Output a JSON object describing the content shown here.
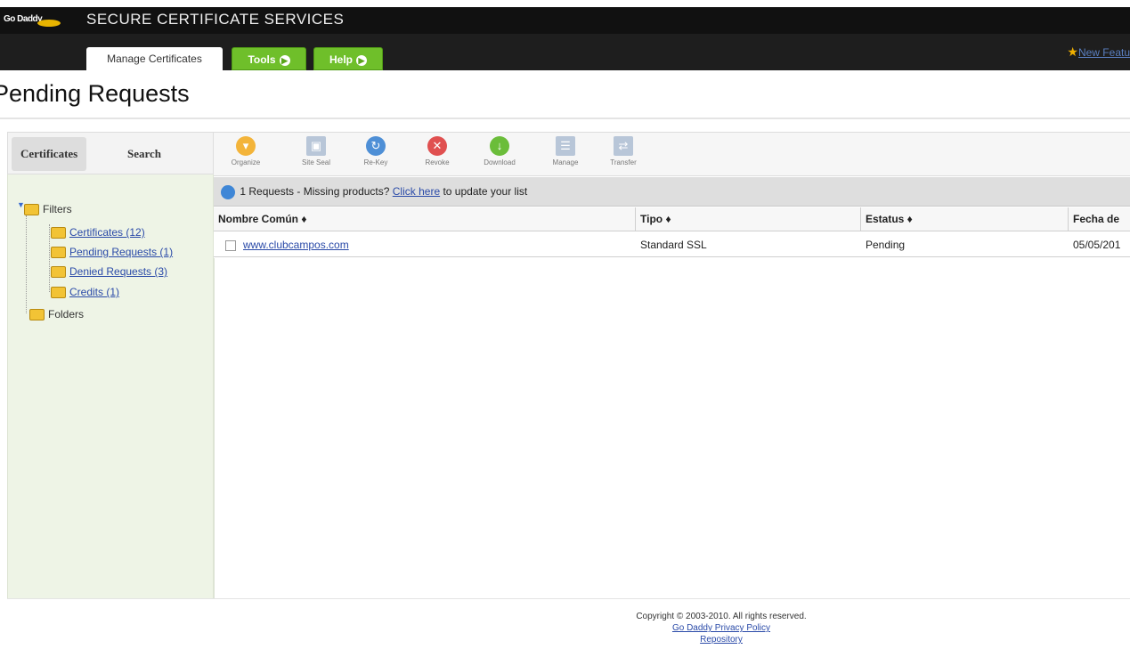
{
  "header": {
    "logo_text": "Go Daddy",
    "app_title": "SECURE CERTIFICATE SERVICES",
    "tabs": [
      {
        "label": "Manage Certificates"
      },
      {
        "label": "Tools"
      },
      {
        "label": "Help"
      }
    ],
    "new_features_label": "New Featu"
  },
  "page": {
    "title": "Pending Requests"
  },
  "sidebar": {
    "tabs": [
      {
        "label": "Certificates"
      },
      {
        "label": "Search"
      }
    ],
    "tree": {
      "root_label": "Filters",
      "items": [
        {
          "label": "Certificates (12)"
        },
        {
          "label": "Pending Requests (1)"
        },
        {
          "label": "Denied Requests (3)"
        },
        {
          "label": "Credits (1)"
        }
      ],
      "folders_label": "Folders"
    }
  },
  "toolbar": {
    "buttons": [
      {
        "label": "Organize",
        "icon": "organize-icon",
        "color": "#f3b43a"
      },
      {
        "label": "Site Seal",
        "icon": "site-seal-icon",
        "color": "#b8c6d8"
      },
      {
        "label": "Re-Key",
        "icon": "rekey-icon",
        "color": "#4e8fd6"
      },
      {
        "label": "Revoke",
        "icon": "revoke-icon",
        "color": "#e05050"
      },
      {
        "label": "Download",
        "icon": "download-icon",
        "color": "#6bbd3a"
      },
      {
        "label": "Manage",
        "icon": "manage-icon",
        "color": "#b8c6d8"
      },
      {
        "label": "Transfer",
        "icon": "transfer-icon",
        "color": "#b8c6d8"
      }
    ]
  },
  "info_bar": {
    "text_before": "1 Requests - Missing products?",
    "link_text": "Click here",
    "text_after": "to update your list"
  },
  "table": {
    "columns": [
      {
        "label": "Nombre Común ♦"
      },
      {
        "label": "Tipo ♦"
      },
      {
        "label": "Estatus ♦"
      },
      {
        "label": "Fecha de"
      }
    ],
    "rows": [
      {
        "name": "www.clubcampos.com",
        "type": "Standard SSL",
        "status": "Pending",
        "date": "05/05/201"
      }
    ]
  },
  "footer": {
    "copyright": "Copyright © 2003-2010. All rights reserved.",
    "privacy_link": "Go Daddy Privacy Policy",
    "repository_link": "Repository"
  }
}
